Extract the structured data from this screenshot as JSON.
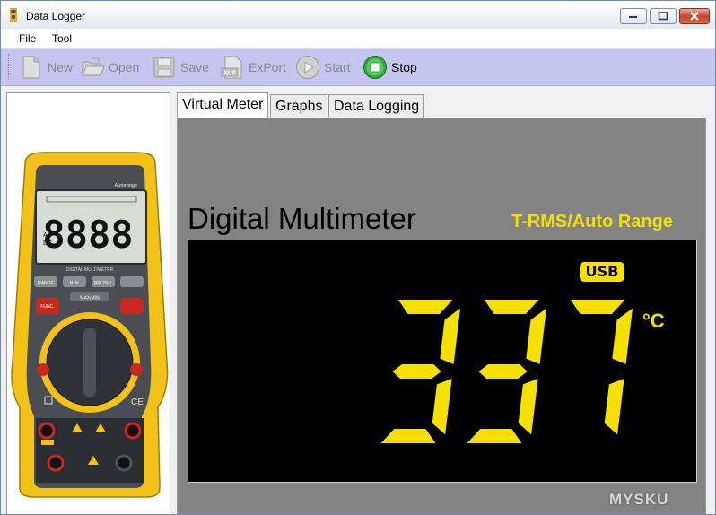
{
  "window": {
    "title": "Data Logger"
  },
  "menu": {
    "items": [
      {
        "label": "File"
      },
      {
        "label": "Tool"
      }
    ]
  },
  "toolbar": {
    "items": [
      {
        "label": "New",
        "icon": "new-document-icon",
        "enabled": false
      },
      {
        "label": "Open",
        "icon": "open-folder-icon",
        "enabled": false
      },
      {
        "label": "Save",
        "icon": "floppy-disk-icon",
        "enabled": false
      },
      {
        "label": "ExPort",
        "icon": "xls-export-icon",
        "enabled": false
      },
      {
        "label": "Start",
        "icon": "play-icon",
        "enabled": false
      },
      {
        "label": "Stop",
        "icon": "stop-icon",
        "enabled": true
      }
    ]
  },
  "tabs": [
    {
      "label": "Virtual Meter",
      "active": true
    },
    {
      "label": "Graphs",
      "active": false
    },
    {
      "label": "Data Logging",
      "active": false
    }
  ],
  "meter": {
    "title": "Digital Multimeter",
    "subtitle": "T-RMS/Auto Range",
    "usb_badge": "USB",
    "reading": "337",
    "unit": "°C"
  },
  "device_image": {
    "lcd_digits": "8888",
    "autorange_label": "Autorange",
    "brand_label": "DIGITAL MULTIMETER",
    "buttons": [
      "RANGE",
      "Hz%",
      "REL/SEL",
      "FUNC.",
      "MAX/MIN"
    ]
  },
  "watermark": "MYSKU",
  "colors": {
    "toolbar": "#c5c5ef",
    "lcd_background": "#000000",
    "segment": "#f5e000",
    "panel": "#838383"
  }
}
